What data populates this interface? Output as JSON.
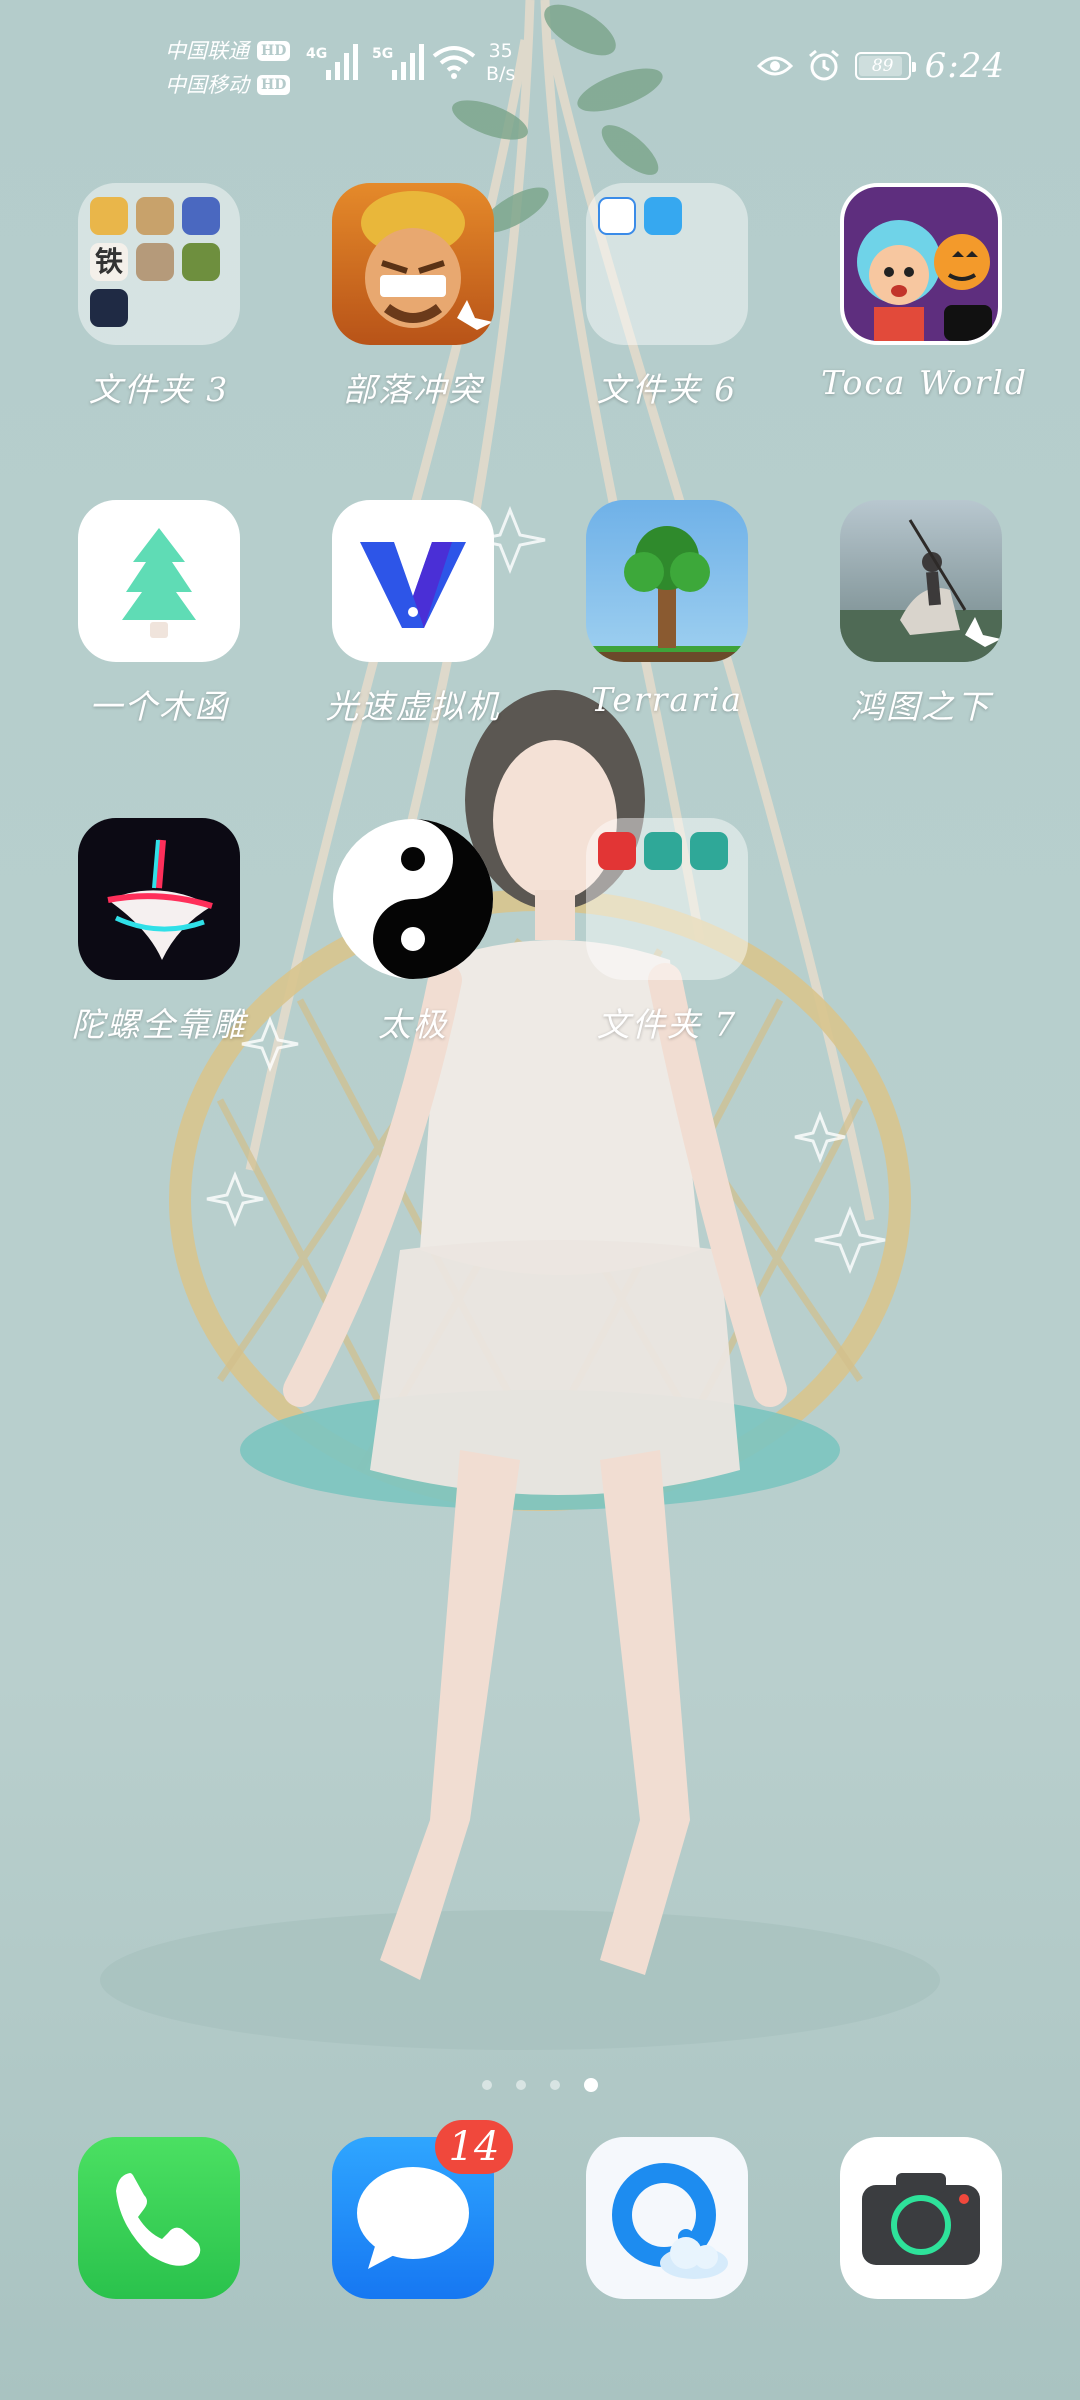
{
  "status_bar": {
    "carrier1": "中国联通",
    "carrier2": "中国移动",
    "hd_label": "HD",
    "net1": "4G",
    "net2": "5G",
    "speed_value": "35",
    "speed_unit": "B/s",
    "battery": "89",
    "time": "6:24",
    "icons": [
      "eye-icon",
      "alarm-icon",
      "battery-icon",
      "wifi-icon",
      "signal-icon"
    ]
  },
  "apps": [
    {
      "label": "文件夹 3",
      "type": "folder"
    },
    {
      "label": "部落冲突",
      "type": "app"
    },
    {
      "label": "文件夹 6",
      "type": "folder"
    },
    {
      "label": "Toca World",
      "type": "app"
    },
    {
      "label": "一个木函",
      "type": "app"
    },
    {
      "label": "光速虚拟机",
      "type": "app"
    },
    {
      "label": "Terraria",
      "type": "app"
    },
    {
      "label": "鸿图之下",
      "type": "app"
    },
    {
      "label": "陀螺全靠雕",
      "type": "app"
    },
    {
      "label": "太极",
      "type": "app"
    },
    {
      "label": "文件夹 7",
      "type": "folder"
    }
  ],
  "folder3_mini_text": "铁",
  "page_indicator": {
    "pages": 4,
    "current": 4
  },
  "dock": {
    "phone": "phone-icon",
    "messages": "messages-icon",
    "messages_badge": "14",
    "browser": "browser-icon",
    "camera": "camera-icon"
  },
  "colors": {
    "wallpaper": "#b4cccb",
    "badge": "#f0483c",
    "phone_green": "#34c759",
    "messages_blue": "#1a8cff"
  }
}
